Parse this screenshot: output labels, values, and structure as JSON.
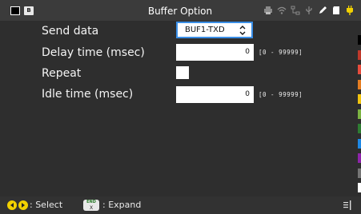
{
  "window": {
    "title": "Buffer Option",
    "left_badge": "B"
  },
  "status_icons": [
    "printer-icon",
    "wifi-icon",
    "network-icon",
    "usb-icon",
    "pen-icon",
    "sd-card-icon",
    "power-plug-icon"
  ],
  "form": {
    "send_data": {
      "label": "Send data",
      "value": "BUF1-TXD"
    },
    "delay_time": {
      "label": "Delay time (msec)",
      "value": "0",
      "range": "[0 - 99999]"
    },
    "repeat": {
      "label": "Repeat",
      "checked": false
    },
    "idle_time": {
      "label": "Idle time (msec)",
      "value": "0",
      "range": "[0 - 99999]"
    }
  },
  "footer": {
    "select_label": ": Select",
    "expand_label": ": Expand",
    "end_key_top": "END",
    "end_key_bottom": "X"
  },
  "colors": {
    "accent_focus": "#3a8ee6",
    "nav_button": "#f2d100",
    "strip": [
      "#000000",
      "#c0392b",
      "#e74c3c",
      "#e67e22",
      "#f1c40f",
      "#7cb342",
      "#2e7d32",
      "#1e88e5",
      "#8e24aa",
      "#757575",
      "#ffffff"
    ]
  }
}
